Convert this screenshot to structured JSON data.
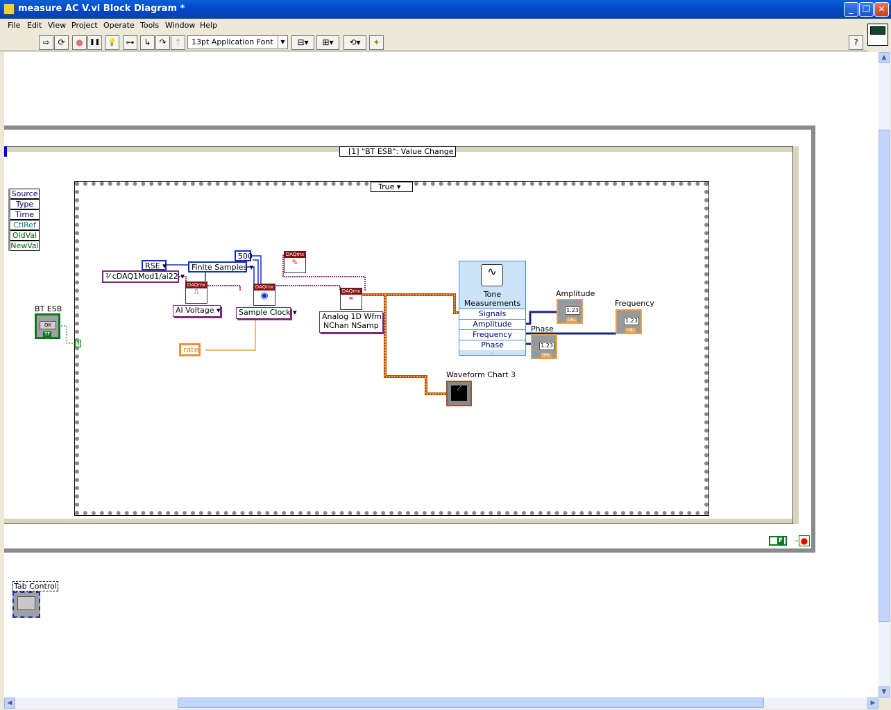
{
  "window": {
    "title": "measure AC V.vi Block Diagram *",
    "minimize": "_",
    "restore": "❐",
    "close": "✕"
  },
  "menu": [
    "File",
    "Edit",
    "View",
    "Project",
    "Operate",
    "Tools",
    "Window",
    "Help"
  ],
  "toolbar": {
    "font": "13pt Application Font",
    "help": "?",
    "run": "⇨",
    "run_continuous": "⟳",
    "abort": "●",
    "pause": "❚❚",
    "highlight": "💡"
  },
  "diagram": {
    "event_case": "[1] \"BT ESB\": Value Change",
    "case_selector": "True",
    "event_data": [
      "Source",
      "Type",
      "Time",
      "CtlRef",
      "OldVal",
      "NewVal"
    ],
    "bt_esb": {
      "label": "BT ESB",
      "button": "OK",
      "type": "TF",
      "selector": "?"
    },
    "physical_channel": "cDAQ1Mod1/ai22",
    "terminal_config": "RSE",
    "sample_mode": "Finite Samples",
    "samples": "500",
    "ai_voltage": "AI Voltage",
    "sample_clock": "Sample Clock",
    "rate": "rate",
    "read_mode": [
      "Analog 1D Wfm",
      "NChan NSamp"
    ],
    "daqmx": "DAQmx",
    "tone": {
      "title": [
        "Tone",
        "Measurements"
      ],
      "rows": [
        "Signals",
        "Amplitude",
        "Frequency",
        "Phase"
      ]
    },
    "indicators": {
      "amplitude": "Amplitude",
      "frequency": "Frequency",
      "phase": "Phase",
      "value": "1.23",
      "type": "DBL"
    },
    "waveform_chart": "Waveform Chart 3",
    "stop_constant": "F",
    "tab_control": "Tab Control"
  },
  "colors": {
    "titlebar": "#0347c8",
    "dbl_wire": "#e8a050",
    "waveform_wire": "#c05000",
    "task_wire": "#8a3a8a",
    "enum_wire": "#1030c0",
    "bool_wire": "#006000"
  }
}
